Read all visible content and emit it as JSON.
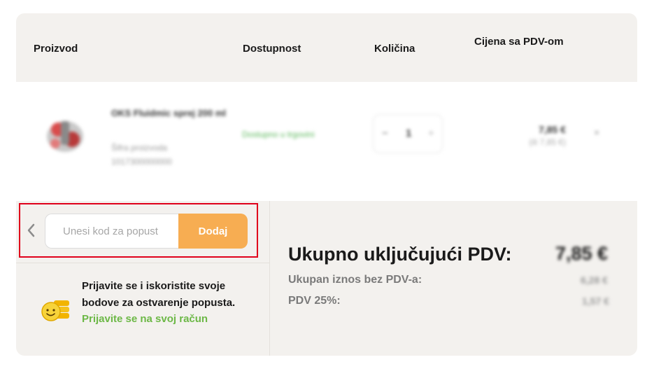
{
  "table_header": {
    "product": "Proizvod",
    "availability": "Dostupnost",
    "quantity": "Količina",
    "price": "Cijena sa PDV-om"
  },
  "cart_item": {
    "name": "OKS Fluidmic sprej 200 ml",
    "code_line1": "Šifra proizvoda",
    "code_line2": "1017300000000",
    "availability": "Dostupno u trgovini",
    "quantity": "1",
    "quantity_minus": "−",
    "quantity_plus": "+",
    "price": "7,85 €",
    "price_sub": "(ili 7,85 €)",
    "remove_symbol": "×"
  },
  "coupon": {
    "placeholder": "Unesi kod za popust",
    "button_label": "Dodaj"
  },
  "login_promo": {
    "text": "Prijavite se i iskoristite svoje bodove za ostvarenje popusta.",
    "link_label": "Prijavite se na svoj račun"
  },
  "summary": {
    "total_label": "Ukupno uključujući PDV:",
    "total_value": "7,85 €",
    "net_label": "Ukupan iznos bez PDV-a:",
    "net_value": "6,28 €",
    "vat_label": "PDV 25%:",
    "vat_value": "1,57 €"
  },
  "colors": {
    "accent": "#f7ad52",
    "link_green": "#6cb846",
    "panel_bg": "#f3f1ee",
    "highlight_red": "#e0001b"
  },
  "icons": {
    "back": "chevron-left-icon",
    "coins": "coins-smiley-icon",
    "remove": "close-icon"
  }
}
